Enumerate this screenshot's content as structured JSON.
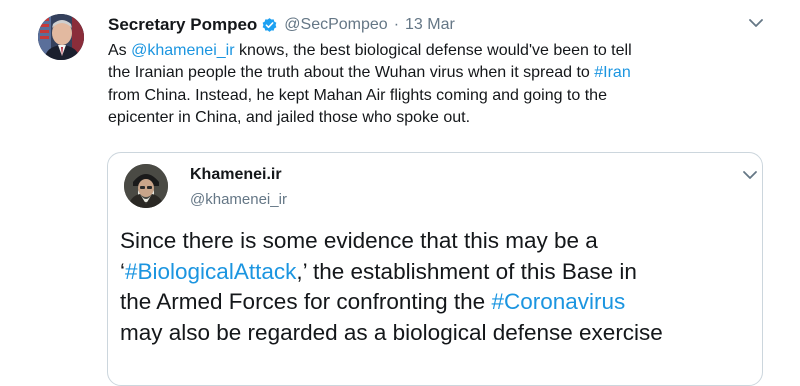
{
  "tweet": {
    "author_name": "Secretary Pompeo",
    "handle": "@SecPompeo",
    "separator": "·",
    "date": "13 Mar",
    "verified_icon": "verified-badge-icon",
    "more_icon": "chevron-down-icon",
    "text_lines": [
      {
        "segments": [
          {
            "text": "As ",
            "link": false
          },
          {
            "text": "@khamenei_ir",
            "link": true
          },
          {
            "text": " knows, the best biological defense would've been to tell",
            "link": false
          }
        ]
      },
      {
        "segments": [
          {
            "text": "the Iranian people the truth about the Wuhan virus when it spread to ",
            "link": false
          },
          {
            "text": "#Iran",
            "link": true
          }
        ]
      },
      {
        "segments": [
          {
            "text": " from China. Instead, he kept Mahan Air flights coming and going to the",
            "link": false
          }
        ]
      },
      {
        "segments": [
          {
            "text": "epicenter in China, and jailed those who spoke out.",
            "link": false
          }
        ]
      }
    ],
    "link_color": "#1b95e0"
  },
  "quoted": {
    "author_name": "Khamenei.ir",
    "handle": "@khamenei_ir",
    "more_icon": "chevron-down-icon",
    "text_lines": [
      {
        "segments": [
          {
            "text": "Since there is some evidence that this may be a",
            "link": false
          }
        ]
      },
      {
        "segments": [
          {
            "text": "‘",
            "link": false
          },
          {
            "text": "#BiologicalAttack",
            "link": true
          },
          {
            "text": ",’ the establishment of this Base in",
            "link": false
          }
        ]
      },
      {
        "segments": [
          {
            "text": "the Armed Forces for confronting the ",
            "link": false
          },
          {
            "text": "#Coronavirus",
            "link": true
          }
        ]
      },
      {
        "segments": [
          {
            "text": " may also be regarded as a biological defense exercise",
            "link": false
          }
        ]
      }
    ]
  }
}
